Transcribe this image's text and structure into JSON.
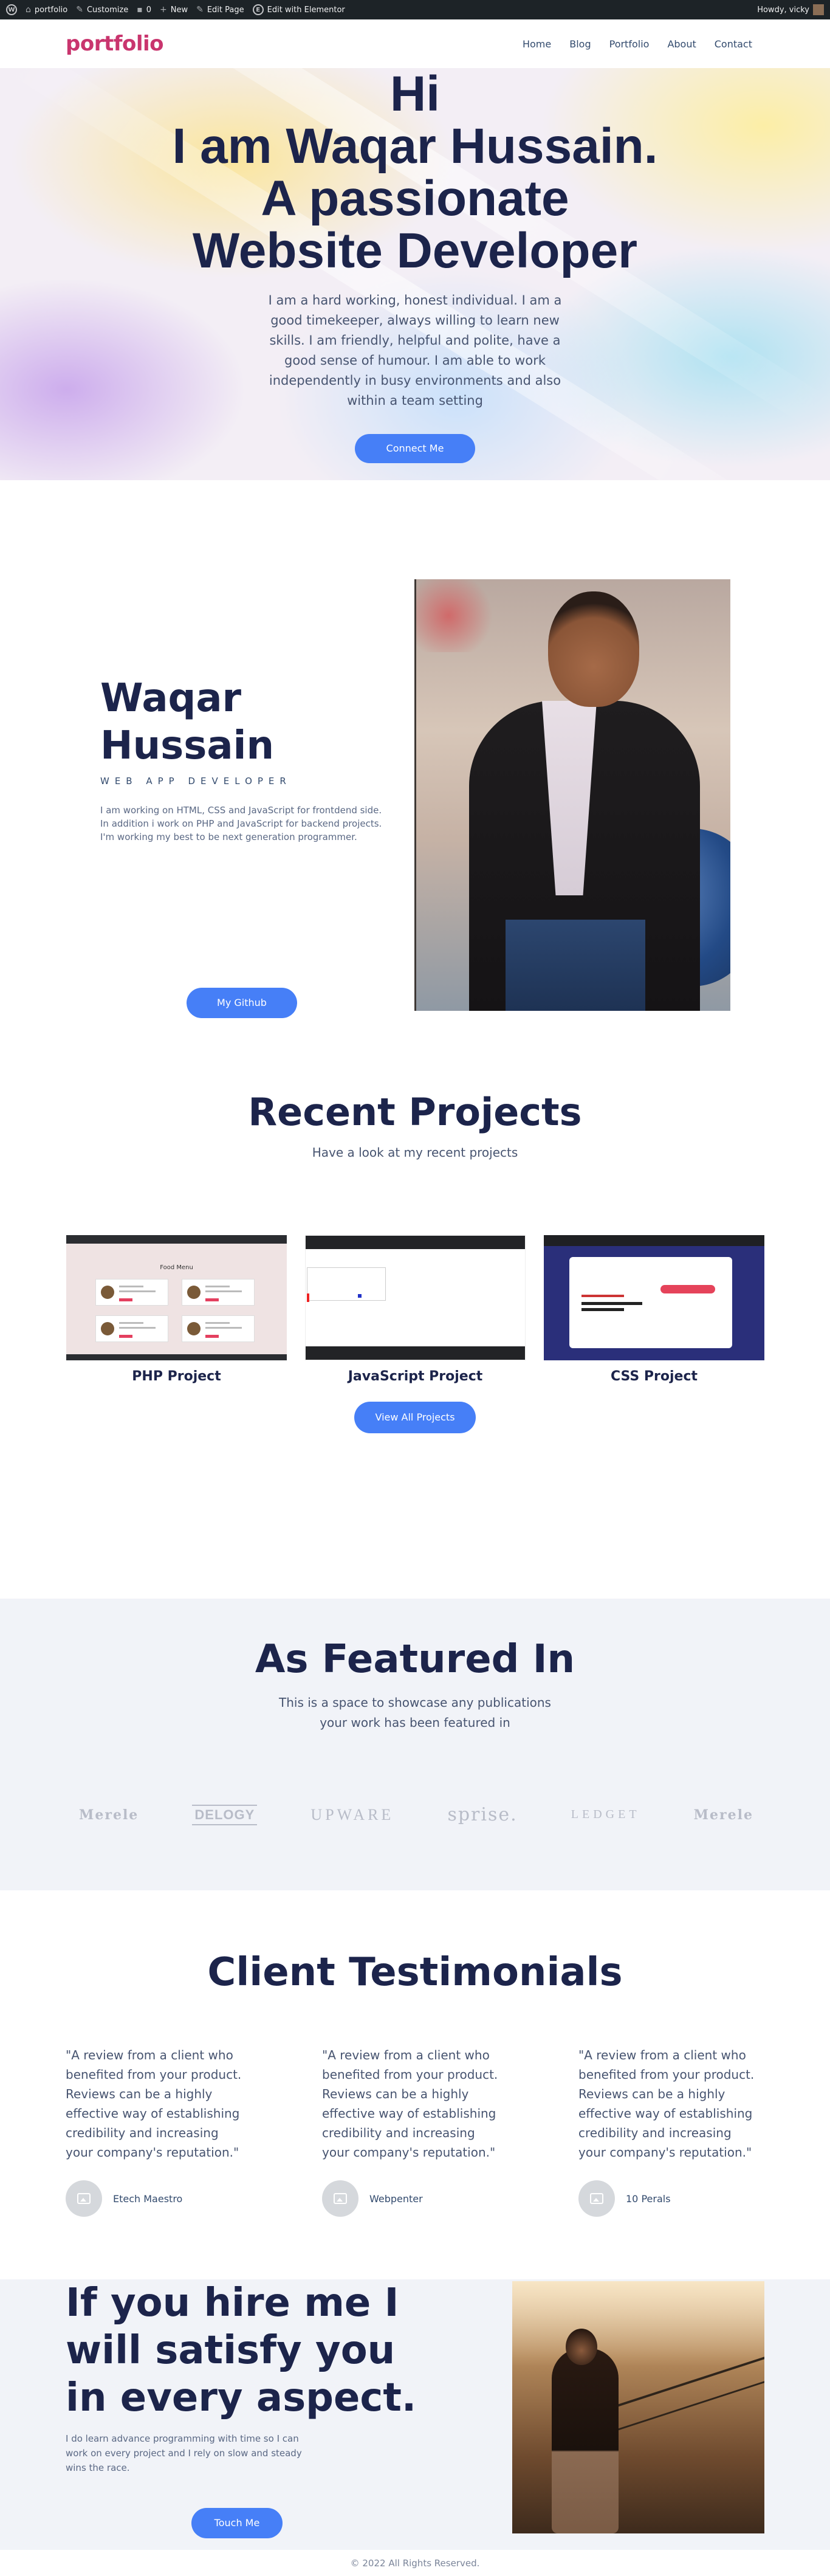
{
  "adminbar": {
    "site": "portfolio",
    "customize": "Customize",
    "comments": "0",
    "new": "New",
    "edit_page": "Edit Page",
    "elementor": "Edit with Elementor",
    "howdy": "Howdy, vicky"
  },
  "header": {
    "logo": "portfolio",
    "nav": [
      "Home",
      "Blog",
      "Portfolio",
      "About",
      "Contact"
    ]
  },
  "hero": {
    "line1": "Hi",
    "line2": "I am Waqar Hussain.",
    "line3": "A passionate",
    "line4": "Website Developer",
    "text": "I am a hard working, honest individual. I am a good timekeeper, always willing to learn new skills. I am friendly, helpful and polite, have a good sense of humour. I am able to work independently in busy environments and also within a team setting",
    "button": "Connect Me"
  },
  "about": {
    "name": "Waqar Hussain",
    "role": "WEB APP DEVELOPER",
    "text": "I am working on HTML, CSS and JavaScript for frontdend side. In addition i work on PHP and JavaScript for backend projects. I'm working my best to be next generation programmer.",
    "button": "My Github"
  },
  "projects": {
    "title": "Recent Projects",
    "subtitle": "Have a look at my recent projects",
    "items": [
      "PHP Project",
      "JavaScript Project",
      "CSS Project"
    ],
    "php_thumb_title": "Food Menu",
    "button": "View All Projects"
  },
  "featured": {
    "title": "As Featured In",
    "text": "This is a space to showcase any publications your work has been featured in",
    "logos": [
      "Merele",
      "DELOGY",
      "UPWARE",
      "sprise.",
      "LEDGET",
      "Merele"
    ]
  },
  "testimonials": {
    "title": "Client Testimonials",
    "items": [
      {
        "quote": "\"A review from a client who benefited from your product. Reviews can be a highly effective way of establishing credibility and increasing your company's reputation.\"",
        "author": "Etech Maestro"
      },
      {
        "quote": "\"A review from a client who benefited from your product. Reviews can be a highly effective way of establishing credibility and increasing your company's reputation.\"",
        "author": "Webpenter"
      },
      {
        "quote": "\"A review from a client who benefited from your product. Reviews can be a highly effective way of establishing credibility and increasing your company's reputation.\"",
        "author": "10 Perals"
      }
    ]
  },
  "hire": {
    "title": "If you hire me I will satisfy you in every aspect.",
    "text": "I do learn advance programming with time so I can work on every project and I rely on slow and steady wins the race.",
    "button": "Touch Me"
  },
  "footer": {
    "copyright": "© 2022 All Rights Reserved."
  }
}
